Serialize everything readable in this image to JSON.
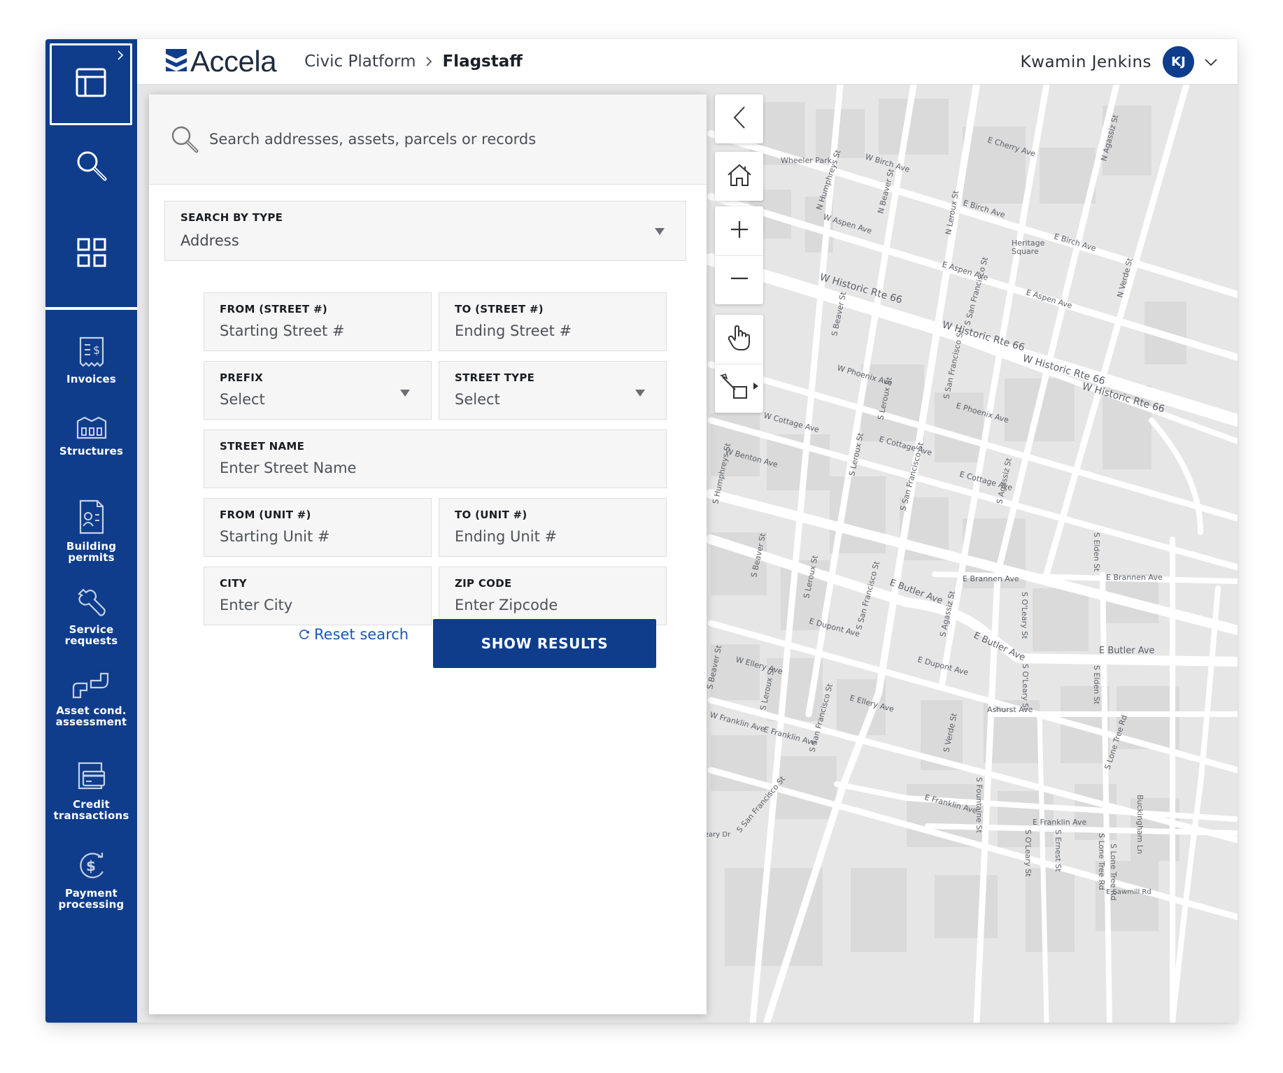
{
  "app": {
    "logo_text": "Accela",
    "breadcrumb": {
      "root": "Civic Platform",
      "current": "Flagstaff"
    },
    "user": {
      "name": "Kwamin  Jenkins",
      "initials": "KJ"
    },
    "accent_color": "#0f3d8c"
  },
  "sidebar": {
    "top_icons": [
      "layout-icon",
      "search-icon",
      "grid-icon"
    ],
    "items": [
      {
        "label": "Invoices",
        "icon": "invoice-icon"
      },
      {
        "label": "Structures",
        "icon": "structures-icon"
      },
      {
        "label": "Building\npermits",
        "icon": "building-permit-icon"
      },
      {
        "label": "Service\nrequests",
        "icon": "wrench-icon"
      },
      {
        "label": "Asset cond.\nassessment",
        "icon": "pipe-icon"
      },
      {
        "label": "Credit\ntransactions",
        "icon": "credit-card-icon"
      },
      {
        "label": "Payment\nprocessing",
        "icon": "dollar-cycle-icon"
      }
    ]
  },
  "search": {
    "placeholder": "Search addresses, assets, parcels or records",
    "type_label": "SEARCH BY TYPE",
    "type_value": "Address",
    "fields": {
      "from_street": {
        "label": "FROM (STREET #)",
        "placeholder": "Starting Street #"
      },
      "to_street": {
        "label": "TO (STREET #)",
        "placeholder": "Ending Street #"
      },
      "prefix": {
        "label": "PREFIX",
        "value": "Select"
      },
      "street_type": {
        "label": "STREET TYPE",
        "value": "Select"
      },
      "street_name": {
        "label": "STREET NAME",
        "placeholder": "Enter Street Name"
      },
      "from_unit": {
        "label": "FROM (UNIT #)",
        "placeholder": "Starting Unit #"
      },
      "to_unit": {
        "label": "TO (UNIT #)",
        "placeholder": "Ending Unit #"
      },
      "city": {
        "label": "CITY",
        "placeholder": "Enter City"
      },
      "zip": {
        "label": "ZIP CODE",
        "placeholder": "Enter Zipcode"
      }
    },
    "reset_label": "Reset search",
    "submit_label": "SHOW RESULTS"
  },
  "map": {
    "controls": [
      "collapse-left-icon",
      "home-icon",
      "zoom-in-icon",
      "zoom-out-icon",
      "pan-hand-icon",
      "draw-shape-icon"
    ],
    "labels": {
      "wheeler_park": "Wheeler Park",
      "heritage_square": "Heritage\nSquare",
      "w_historic_66": "W Historic Rte 66",
      "w_historic_66b": "W Historic Rte 66",
      "w_historic_66c": "W Historic Rte 66",
      "w_historic_66d": "W Historic Rte 66",
      "e_butler_ave": "E Butler Ave",
      "e_butler_ave2": "E Butler Ave",
      "e_butler_ave3": "E Butler Ave",
      "e_cherry_ave": "E Cherry Ave",
      "w_birch_ave": "W Birch Ave",
      "e_birch_ave": "E Birch Ave",
      "e_birch_ave2": "E Birch Ave",
      "w_aspen_ave": "W Aspen Ave",
      "e_aspen_ave": "E Aspen Ave",
      "e_aspen_ave2": "E Aspen Ave",
      "w_phoenix_ave": "W Phoenix Ave",
      "e_phoenix_ave": "E Phoenix Ave",
      "w_cottage_ave": "W Cottage Ave",
      "e_cottage_ave": "E Cottage Ave",
      "e_cottage_ave2": "E Cottage Ave",
      "w_benton_ave": "W Benton Ave",
      "e_brannen_ave": "E Brannen Ave",
      "e_brannen_ave2": "E Brannen Ave",
      "e_dupont_ave": "E Dupont Ave",
      "e_dupont_ave2": "E Dupont Ave",
      "w_ellery_ave": "W Ellery Ave",
      "e_ellery_ave": "E Ellery Ave",
      "w_franklin_ave": "W Franklin Ave",
      "e_franklin_ave": "E Franklin Ave",
      "e_franklin_ave2": "E Franklin Ave",
      "e_franklin_ave3": "E Franklin Ave",
      "ashurst_ave": "Ashurst Ave",
      "e_sawmill_rd": "E Sawmill Rd",
      "creary_dr": "Creary Dr",
      "n_humphreys": "N Humphreys St",
      "n_beaver": "N Beaver St",
      "n_leroux": "N Leroux St",
      "n_agassiz": "N Agassiz St",
      "n_verde": "N Verde St",
      "s_beaver": "S Beaver St",
      "s_beaver2": "S Beaver St",
      "s_beaver3": "S Beaver St",
      "s_san_francisco": "S San Francisco St",
      "s_san_francisco2": "S San Francisco St",
      "s_san_francisco3": "S San Francisco St",
      "s_san_francisco4": "S San Francisco St",
      "s_san_francisco5": "S San Francisco St",
      "s_san_francisco6": "S San Francisco St",
      "s_leroux": "S Leroux St",
      "s_leroux2": "S Leroux St",
      "s_leroux3": "S Leroux St",
      "s_leroux4": "S Leroux St",
      "s_humphreys": "S Humphreys St",
      "s_agassiz": "S Agassiz St",
      "s_agassiz2": "S Agassiz St",
      "s_oleary": "S O'Leary St",
      "s_oleary2": "S O'Leary St",
      "s_oleary3": "S O'Leary St",
      "s_elden": "S Elden St",
      "s_elden2": "S Elden St",
      "s_verde": "S Verde St",
      "s_fountaine": "S Fountaine St",
      "s_ernest": "S Ernest St",
      "s_lone_tree": "S Lone Tree Rd",
      "s_lone_tree2": "S Lone Tree Rd",
      "s_lone_tree3": "S Lone Tree Rd",
      "buckingham": "Buckingham Ln"
    }
  }
}
